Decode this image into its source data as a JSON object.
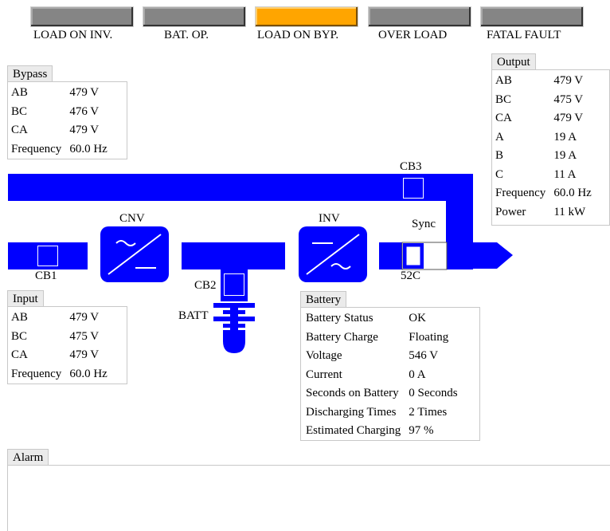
{
  "indicators": [
    {
      "label": "LOAD ON INV.",
      "active": false
    },
    {
      "label": "BAT. OP.",
      "active": false
    },
    {
      "label": "LOAD ON BYP.",
      "active": true
    },
    {
      "label": "OVER LOAD",
      "active": false
    },
    {
      "label": "FATAL FAULT",
      "active": false
    }
  ],
  "colors": {
    "indicator_off": "#858585",
    "indicator_on": "#ffa500",
    "bus": "#0000ff"
  },
  "bypass": {
    "title": "Bypass",
    "rows": [
      [
        "AB",
        "479 V"
      ],
      [
        "BC",
        "476 V"
      ],
      [
        "CA",
        "479 V"
      ],
      [
        "Frequency",
        "60.0 Hz"
      ]
    ]
  },
  "input": {
    "title": "Input",
    "rows": [
      [
        "AB",
        "479 V"
      ],
      [
        "BC",
        "475 V"
      ],
      [
        "CA",
        "479 V"
      ],
      [
        "Frequency",
        "60.0 Hz"
      ]
    ]
  },
  "output": {
    "title": "Output",
    "rows": [
      [
        "AB",
        "479 V"
      ],
      [
        "BC",
        "475 V"
      ],
      [
        "CA",
        "479 V"
      ],
      [
        "A",
        "19 A"
      ],
      [
        "B",
        "19 A"
      ],
      [
        "C",
        "11 A"
      ],
      [
        "Frequency",
        "60.0 Hz"
      ],
      [
        "Power",
        "11 kW"
      ]
    ]
  },
  "battery": {
    "title": "Battery",
    "rows": [
      [
        "Battery Status",
        "OK"
      ],
      [
        "Battery Charge",
        "Floating"
      ],
      [
        "Voltage",
        "546 V"
      ],
      [
        "Current",
        "0 A"
      ],
      [
        "Seconds on Battery",
        "0 Seconds"
      ],
      [
        "Discharging Times",
        "2 Times"
      ],
      [
        "Estimated Charging",
        "97 %"
      ]
    ]
  },
  "diagram": {
    "cb1": "CB1",
    "cb2": "CB2",
    "cb3": "CB3",
    "cnv": "CNV",
    "inv": "INV",
    "sync": "Sync",
    "switch": "52C",
    "batt": "BATT"
  },
  "alarm": {
    "title": "Alarm"
  },
  "icons": {
    "converter": "converter-icon",
    "inverter": "inverter-icon",
    "battery": "battery-icon"
  }
}
